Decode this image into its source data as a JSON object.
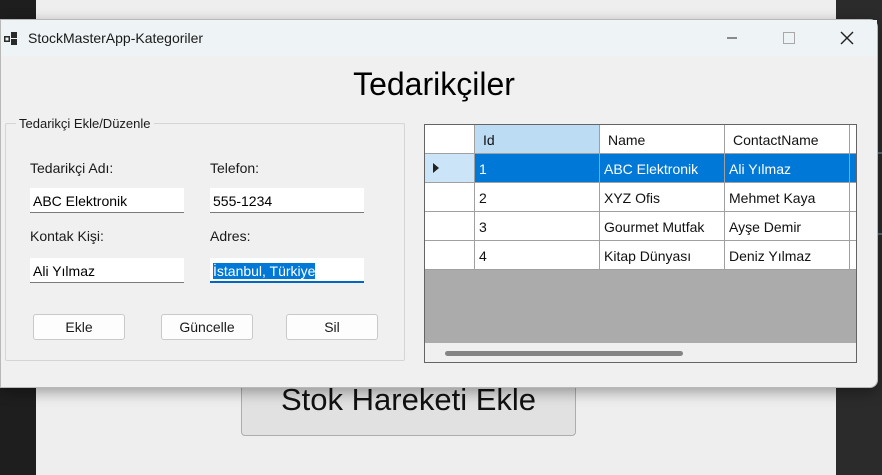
{
  "background": {
    "button_label": "Stok Hareketi Ekle"
  },
  "window": {
    "title": "StockMasterApp-Kategoriler"
  },
  "heading": "Tedarikçiler",
  "form": {
    "group_title": "Tedarikçi Ekle/Düzenle",
    "labels": {
      "name": "Tedarikçi Adı:",
      "phone": "Telefon:",
      "contact": "Kontak Kişi:",
      "address": "Adres:"
    },
    "values": {
      "name": "ABC Elektronik",
      "phone": "555-1234",
      "contact": "Ali Yılmaz",
      "address": "İstanbul, Türkiye"
    },
    "buttons": {
      "add": "Ekle",
      "update": "Güncelle",
      "delete": "Sil"
    }
  },
  "grid": {
    "columns": [
      "Id",
      "Name",
      "ContactName"
    ],
    "rows": [
      {
        "id": "1",
        "name": "ABC Elektronik",
        "contact": "Ali Yılmaz"
      },
      {
        "id": "2",
        "name": "XYZ Ofis",
        "contact": "Mehmet Kaya"
      },
      {
        "id": "3",
        "name": "Gourmet Mutfak",
        "contact": "Ayşe Demir"
      },
      {
        "id": "4",
        "name": "Kitap Dünyası",
        "contact": "Deniz Yılmaz"
      }
    ],
    "selected_row": 1
  },
  "colors": {
    "selection": "#0078d7",
    "sorted_header": "#bcdcf4",
    "grid_empty": "#ababab"
  },
  "icons": [
    "app-icon",
    "minimize-icon",
    "maximize-icon",
    "close-icon",
    "row-pointer-icon"
  ]
}
